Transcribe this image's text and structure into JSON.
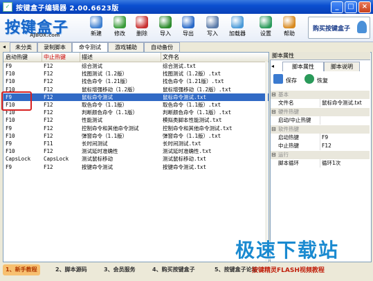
{
  "window": {
    "title": "按键盒子编辑器 2.00.6623版"
  },
  "logo": {
    "text_zh": "按键盒子",
    "text_en": "AJBOX.com"
  },
  "toolbar": [
    {
      "label": "新建",
      "icon": "new-file-icon",
      "color": "#3d7fd0"
    },
    {
      "label": "修改",
      "icon": "edit-icon",
      "color": "#3a9c3a"
    },
    {
      "label": "删除",
      "icon": "delete-icon",
      "color": "#c83030"
    },
    {
      "label": "导入",
      "icon": "import-icon",
      "color": "#2a8a2a"
    },
    {
      "label": "导出",
      "icon": "export-icon",
      "color": "#2a6ac8"
    },
    {
      "label": "写入",
      "icon": "write-icon",
      "color": "#5a7aa8"
    },
    {
      "label": "加载器",
      "icon": "loader-icon",
      "color": "#4a9ad8"
    },
    {
      "label": "设置",
      "icon": "settings-icon",
      "color": "#2a9a5a"
    },
    {
      "label": "帮助",
      "icon": "help-icon",
      "color": "#d88a20"
    }
  ],
  "buy_button": "购买按键盒子",
  "tabs": [
    "未分类",
    "录制脚本",
    "命令测试",
    "游戏辅助",
    "自动备份"
  ],
  "active_tab": "命令测试",
  "list": {
    "headers": [
      "启动热键",
      "中止热键",
      "描述",
      "文件名"
    ],
    "rows": [
      [
        "F9",
        "F12",
        "综合测试",
        "综合测试.txt"
      ],
      [
        "F10",
        "F12",
        "找图测试（1.2版）",
        "找图测试（1.2版）.txt"
      ],
      [
        "F10",
        "F12",
        "找色命令（1.21版）",
        "找色命令（1.21版）.txt"
      ],
      [
        "F10",
        "F12",
        "鼠标增强移动（1.2版）",
        "鼠标增强移动（1.2版）.txt"
      ],
      [
        "F9",
        "F12",
        "鼠标命令测试",
        "鼠标命令测试.txt"
      ],
      [
        "F10",
        "F12",
        "取色命令（1.1版）",
        "取色命令（1.1版）.txt"
      ],
      [
        "F10",
        "F12",
        "判断颜色命令（1.1版）",
        "判断颜色命令（1.1版）.txt"
      ],
      [
        "F10",
        "F12",
        "性能测试",
        "模拟类脚本性能测试.txt"
      ],
      [
        "F9",
        "F12",
        "控制命令和其他命令测试",
        "控制命令和其他命令测试.txt"
      ],
      [
        "F10",
        "F12",
        "弹窗命令（1.1版）",
        "弹窗命令（1.1版）.txt"
      ],
      [
        "F9",
        "F11",
        "长时间测试",
        "长时间测试.txt"
      ],
      [
        "F10",
        "F12",
        "测试延时准确性",
        "测试延时准确性.txt"
      ],
      [
        "CapsLock",
        "CapsLock",
        "测试鼠标移动",
        "测试鼠标移动.txt"
      ],
      [
        "F9",
        "F12",
        "按键命令测试",
        "按键命令测试.txt"
      ]
    ],
    "selected_index": 4
  },
  "props": {
    "title": "脚本属性",
    "tabs": [
      "脚本属性",
      "脚本说明"
    ],
    "save": "保存",
    "restore": "恢复",
    "rows": [
      {
        "cat": true,
        "k": "基本"
      },
      {
        "k": "文件名",
        "v": "鼠标命令测试.txt"
      },
      {
        "cat": true,
        "k": "硬件热键"
      },
      {
        "k": "启动/中止热键",
        "v": ""
      },
      {
        "cat": true,
        "k": "软件热键"
      },
      {
        "k": "启动热键",
        "v": "F9"
      },
      {
        "k": "中止热键",
        "v": "F12"
      },
      {
        "cat": true,
        "k": "运行"
      },
      {
        "k": "脚本循环",
        "v": "循环1次"
      }
    ]
  },
  "bottom_tabs": [
    "1、新手教程",
    "2、脚本源码",
    "3、会员服务",
    "4、购买按键盒子",
    "5、按键盒子论坛"
  ],
  "promo": "按键精灵FLASH视频教程",
  "watermark": "极速下载站"
}
